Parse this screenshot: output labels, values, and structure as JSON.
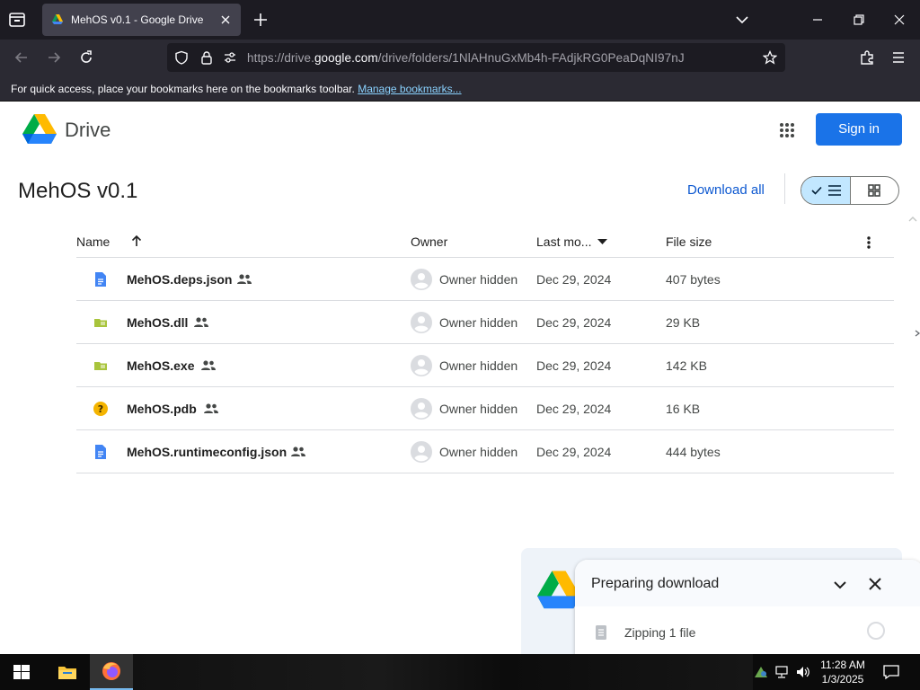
{
  "browser": {
    "tab_title": "MehOS v0.1 - Google Drive",
    "url_prefix": "https://drive.",
    "url_domain": "google.com",
    "url_path": "/drive/folders/1NlAHnuGxMb4h-FAdjkRG0PeaDqNI97nJ",
    "bookmarks_message": "For quick access, place your bookmarks here on the bookmarks toolbar.",
    "bookmarks_link": "Manage bookmarks..."
  },
  "drive": {
    "app_name": "Drive",
    "sign_in": "Sign in",
    "folder_title": "MehOS v0.1",
    "download_all": "Download all",
    "columns": {
      "name": "Name",
      "owner": "Owner",
      "modified": "Last mo...",
      "size": "File size"
    },
    "files": [
      {
        "name": "MehOS.deps.json",
        "icon": "doc-icon",
        "owner": "Owner hidden",
        "modified": "Dec 29, 2024",
        "size": "407 bytes"
      },
      {
        "name": "MehOS.dll",
        "icon": "binary-file-icon",
        "owner": "Owner hidden",
        "modified": "Dec 29, 2024",
        "size": "29 KB"
      },
      {
        "name": "MehOS.exe",
        "icon": "binary-file-icon",
        "owner": "Owner hidden",
        "modified": "Dec 29, 2024",
        "size": "142 KB"
      },
      {
        "name": "MehOS.pdb",
        "icon": "unknown-file-icon",
        "owner": "Owner hidden",
        "modified": "Dec 29, 2024",
        "size": "16 KB"
      },
      {
        "name": "MehOS.runtimeconfig.json",
        "icon": "doc-icon",
        "owner": "Owner hidden",
        "modified": "Dec 29, 2024",
        "size": "444 bytes"
      }
    ]
  },
  "download_popup": {
    "title": "Preparing download",
    "status": "Zipping 1 file"
  },
  "taskbar": {
    "time": "11:28 AM",
    "date": "1/3/2025"
  },
  "colors": {
    "accent_blue": "#1a73e8",
    "link_blue": "#0b57d0",
    "list_toggle_active": "#c2e7ff"
  }
}
